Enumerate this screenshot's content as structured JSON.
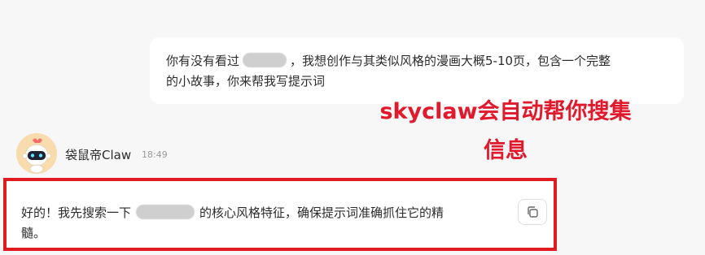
{
  "user_message": {
    "line1_before": "你有没有看过",
    "line1_after": "，我想创作与其类似风格的漫画大概5-10页，包含一个完整",
    "line2": "的小故事，你来帮我写提示词"
  },
  "annotation": {
    "text": "skyclaw会自动帮你搜集信息",
    "color": "#e0192c"
  },
  "bot": {
    "name": "袋鼠帝Claw",
    "time": "18:49",
    "avatar_icon": "robot-avatar-icon"
  },
  "reply": {
    "text_before": "好的！我先搜索一下",
    "text_after": "的核心风格特征，确保提示词准确抓住它的精",
    "text_line2": "髓。",
    "highlight_color": "#e11b22"
  },
  "actions": {
    "copy_icon": "copy-icon"
  }
}
